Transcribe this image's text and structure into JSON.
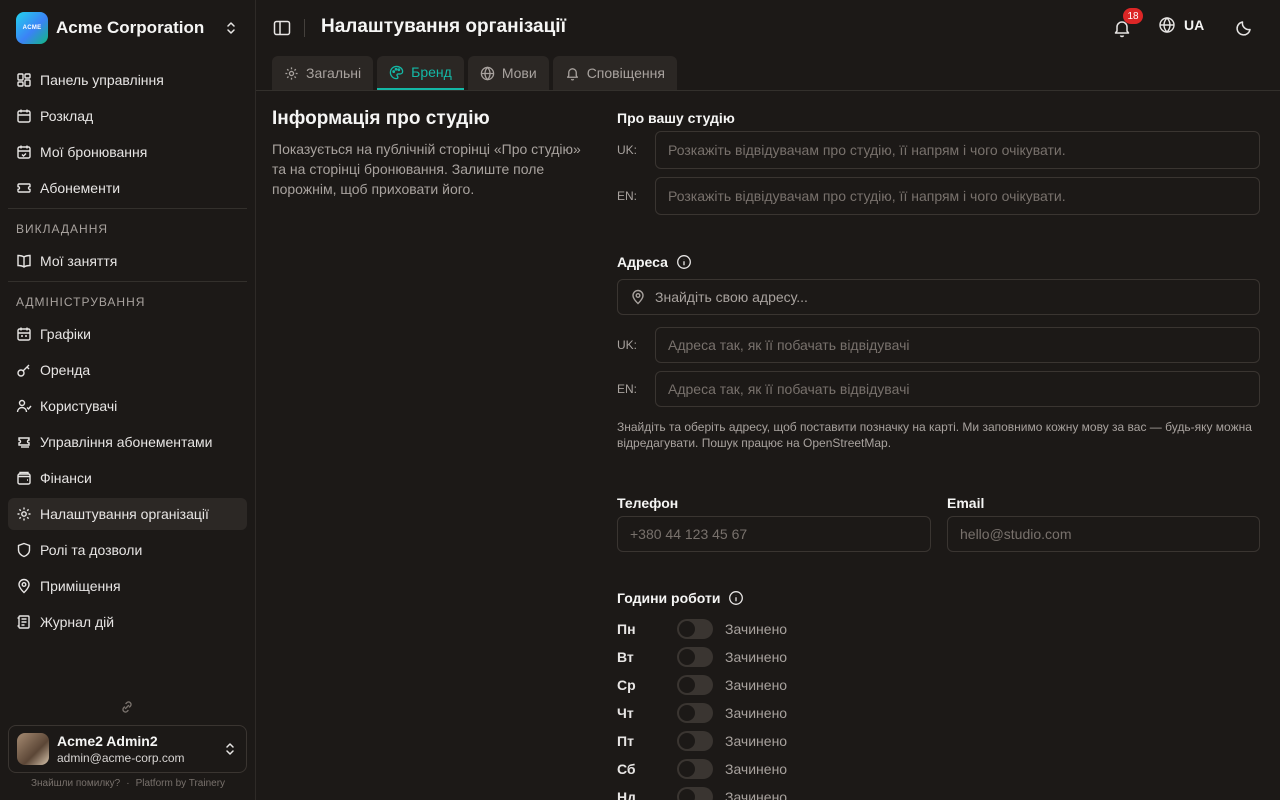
{
  "org": {
    "name": "Acme Corporation",
    "logo_text": "ACME"
  },
  "sidebar": {
    "main": [
      {
        "label": "Панель управління",
        "icon": "dashboard-icon"
      },
      {
        "label": "Розклад",
        "icon": "calendar-icon"
      },
      {
        "label": "Мої бронювання",
        "icon": "calendar-check-icon"
      },
      {
        "label": "Абонементи",
        "icon": "ticket-icon"
      }
    ],
    "teaching_label": "Викладання",
    "teaching": [
      {
        "label": "Мої заняття",
        "icon": "book-open-icon"
      }
    ],
    "admin_label": "Адміністрування",
    "admin": [
      {
        "label": "Графіки",
        "icon": "calendar-range-icon"
      },
      {
        "label": "Оренда",
        "icon": "key-icon"
      },
      {
        "label": "Користувачі",
        "icon": "users-icon"
      },
      {
        "label": "Управління абонементами",
        "icon": "tickets-icon"
      },
      {
        "label": "Фінанси",
        "icon": "wallet-icon"
      },
      {
        "label": "Налаштування організації",
        "icon": "gear-icon",
        "active": true
      },
      {
        "label": "Ролі та дозволи",
        "icon": "shield-icon"
      },
      {
        "label": "Приміщення",
        "icon": "map-pin-icon"
      },
      {
        "label": "Журнал дій",
        "icon": "log-icon"
      }
    ]
  },
  "user": {
    "name": "Acme2 Admin2",
    "email": "admin@acme-corp.com"
  },
  "footer": {
    "report": "Знайшли помилку?",
    "platform": "Platform by Trainery"
  },
  "header": {
    "title": "Налаштування організації",
    "notifications": "18",
    "lang": "UA"
  },
  "tabs": [
    {
      "label": "Загальні",
      "icon": "gear-icon"
    },
    {
      "label": "Бренд",
      "icon": "palette-icon",
      "active": true
    },
    {
      "label": "Мови",
      "icon": "globe-icon"
    },
    {
      "label": "Сповіщення",
      "icon": "bell-icon"
    }
  ],
  "section": {
    "title": "Інформація про студію",
    "description": "Показується на публічній сторінці «Про студію» та на сторінці бронювання. Залиште поле порожнім, щоб приховати його."
  },
  "about": {
    "label": "Про вашу студію",
    "uk_tag": "UK:",
    "en_tag": "EN:",
    "uk_placeholder": "Розкажіть відвідувачам про студію, її напрям і чого очікувати.",
    "en_placeholder": "Розкажіть відвідувачам про студію, її напрям і чого очікувати."
  },
  "address": {
    "label": "Адреса",
    "search_placeholder": "Знайдіть свою адресу...",
    "uk_tag": "UK:",
    "en_tag": "EN:",
    "uk_placeholder": "Адреса так, як її побачать відвідувачі",
    "en_placeholder": "Адреса так, як її побачать відвідувачі",
    "hint": "Знайдіть та оберіть адресу, щоб поставити позначку на карті. Ми заповнимо кожну мову за вас — будь-яку можна відредагувати. Пошук працює на OpenStreetMap."
  },
  "phone": {
    "label": "Телефон",
    "placeholder": "+380 44 123 45 67"
  },
  "email": {
    "label": "Email",
    "placeholder": "hello@studio.com"
  },
  "hours": {
    "label": "Години роботи",
    "closed_label": "Зачинено",
    "days": [
      "Пн",
      "Вт",
      "Ср",
      "Чт",
      "Пт",
      "Сб",
      "Нд"
    ]
  },
  "colors": {
    "accent": "#14b8a6",
    "badge": "#dc2626",
    "background": "#1c1917"
  }
}
